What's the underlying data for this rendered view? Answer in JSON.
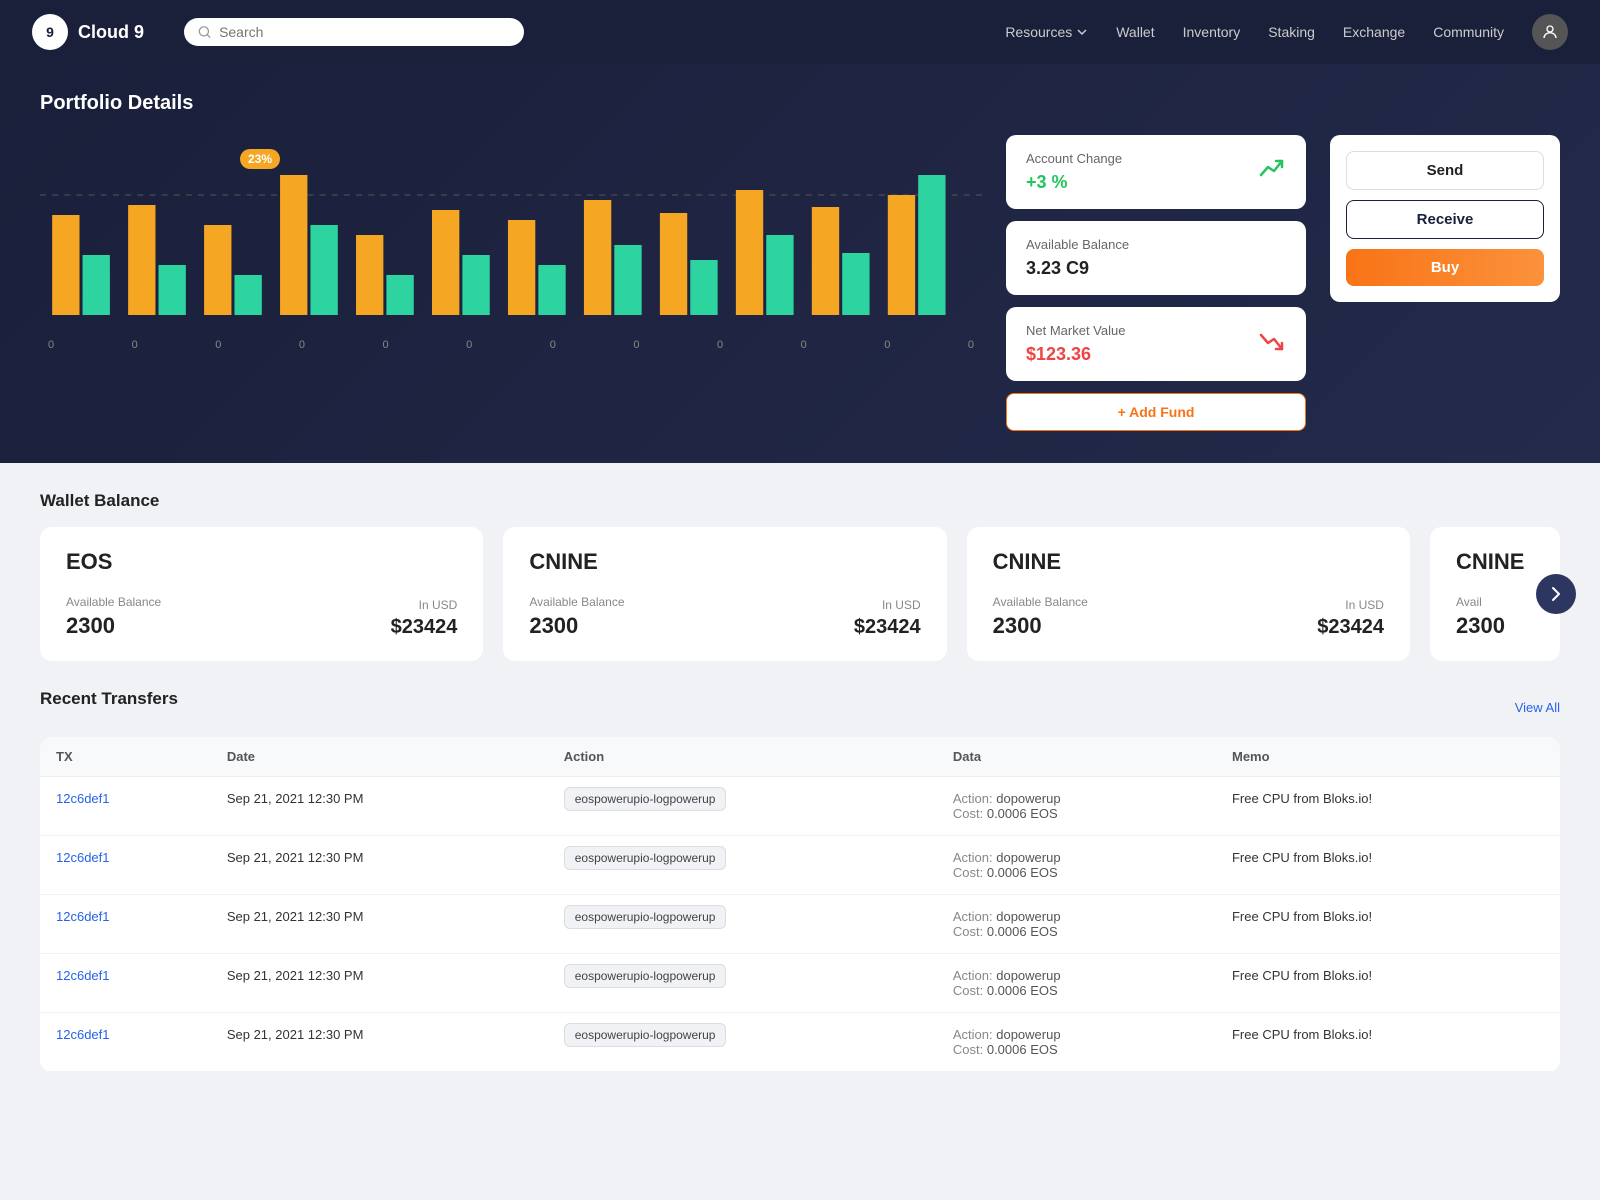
{
  "brand": {
    "logo_text": "9",
    "name": "Cloud 9"
  },
  "search": {
    "placeholder": "Search"
  },
  "nav": {
    "resources": "Resources",
    "wallet": "Wallet",
    "inventory": "Inventory",
    "staking": "Staking",
    "exchange": "Exchange",
    "community": "Community"
  },
  "hero": {
    "title": "Portfolio Details",
    "chart_badge": "23%",
    "chart_x_labels": [
      "0",
      "0",
      "0",
      "0",
      "0",
      "0",
      "0",
      "0",
      "0",
      "0",
      "0",
      "0"
    ]
  },
  "account_change": {
    "label": "Account Change",
    "value": "+3 %",
    "icon": "↗"
  },
  "available_balance": {
    "label": "Available Balance",
    "value": "3.23 C9"
  },
  "net_market_value": {
    "label": "Net Market Value",
    "value": "$123.36",
    "icon": "↘"
  },
  "add_fund": {
    "label": "+ Add Fund"
  },
  "buttons": {
    "send": "Send",
    "receive": "Receive",
    "buy": "Buy"
  },
  "wallet_balance": {
    "title": "Wallet Balance",
    "cards": [
      {
        "token": "EOS",
        "available_label": "Available Balance",
        "available_value": "2300",
        "usd_label": "In USD",
        "usd_value": "$23424"
      },
      {
        "token": "CNINE",
        "available_label": "Available Balance",
        "available_value": "2300",
        "usd_label": "In USD",
        "usd_value": "$23424"
      },
      {
        "token": "CNINE",
        "available_label": "Available Balance",
        "available_value": "2300",
        "usd_label": "In USD",
        "usd_value": "$23424"
      }
    ],
    "partial_token": "CNINE",
    "partial_avail_label": "Avail",
    "partial_avail_value": "2300"
  },
  "recent_transfers": {
    "title": "Recent Transfers",
    "view_all": "View All",
    "columns": [
      "TX",
      "Date",
      "Action",
      "Data",
      "Memo"
    ],
    "rows": [
      {
        "tx": "12c6def1",
        "date": "Sep 21, 2021  12:30 PM",
        "action": "eospowerupio-logpowerup",
        "data_action": "dopowerup",
        "data_cost": "0.0006 EOS",
        "memo": "Free CPU from Bloks.io!"
      },
      {
        "tx": "12c6def1",
        "date": "Sep 21, 2021  12:30 PM",
        "action": "eospowerupio-logpowerup",
        "data_action": "dopowerup",
        "data_cost": "0.0006 EOS",
        "memo": "Free CPU from Bloks.io!"
      },
      {
        "tx": "12c6def1",
        "date": "Sep 21, 2021  12:30 PM",
        "action": "eospowerupio-logpowerup",
        "data_action": "dopowerup",
        "data_cost": "0.0006 EOS",
        "memo": "Free CPU from Bloks.io!"
      },
      {
        "tx": "12c6def1",
        "date": "Sep 21, 2021  12:30 PM",
        "action": "eospowerupio-logpowerup",
        "data_action": "dopowerup",
        "data_cost": "0.0006 EOS",
        "memo": "Free CPU from Bloks.io!"
      },
      {
        "tx": "12c6def1",
        "date": "Sep 21, 2021  12:30 PM",
        "action": "eospowerupio-logpowerup",
        "data_action": "dopowerup",
        "data_cost": "0.0006 EOS",
        "memo": "Free CPU from Bloks.io!"
      }
    ]
  },
  "colors": {
    "bar_yellow": "#f5a623",
    "bar_green": "#2dd4a0",
    "accent_blue": "#2563eb",
    "accent_orange": "#f97316",
    "accent_green": "#22c55e",
    "accent_red": "#ef4444",
    "dark_nav": "#1a1f3a"
  }
}
